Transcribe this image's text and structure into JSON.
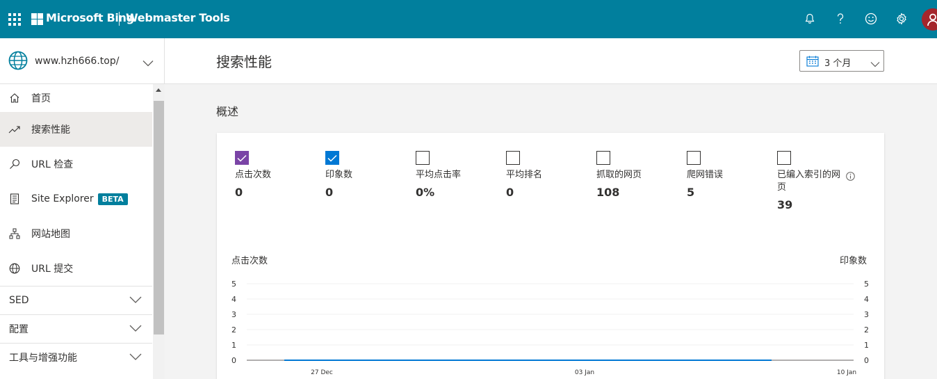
{
  "topbar": {
    "brand": "Microsoft Bing",
    "product": "Webmaster Tools",
    "icons": [
      "apps-waffle-icon",
      "bell-icon",
      "help-icon",
      "feedback-smile-icon",
      "gear-icon",
      "avatar-icon"
    ],
    "color": "#017f9d"
  },
  "site": {
    "url": "www.hzh666.top/"
  },
  "nav": {
    "items": [
      {
        "label": "首页",
        "icon": "home-icon"
      },
      {
        "label": "搜索性能",
        "icon": "trend-icon",
        "active": true
      },
      {
        "label": "URL 检查",
        "icon": "search-icon"
      },
      {
        "label": "Site Explorer",
        "icon": "document-icon",
        "badge": "BETA"
      },
      {
        "label": "网站地图",
        "icon": "sitemap-icon"
      },
      {
        "label": "URL 提交",
        "icon": "globe-icon"
      }
    ],
    "groups": [
      {
        "label": "SED"
      },
      {
        "label": "配置"
      },
      {
        "label": "工具与增强功能"
      }
    ]
  },
  "page": {
    "title": "搜索性能",
    "date_range": "3 个月",
    "section": "概述"
  },
  "metrics": [
    {
      "label": "点击次数",
      "value": "0",
      "checked": true,
      "color": "#7a44a6"
    },
    {
      "label": "印象数",
      "value": "0",
      "checked": true,
      "color": "#0078d4"
    },
    {
      "label": "平均点击率",
      "value": "0%",
      "checked": false
    },
    {
      "label": "平均排名",
      "value": "0",
      "checked": false
    },
    {
      "label": "抓取的网页",
      "value": "108",
      "checked": false
    },
    {
      "label": "爬网错误",
      "value": "5",
      "checked": false
    },
    {
      "label": "已编入索引的网页",
      "value": "39",
      "checked": false,
      "info": true
    }
  ],
  "chart_data": {
    "type": "line",
    "left_axis_label": "点击次数",
    "right_axis_label": "印象数",
    "y_ticks": [
      "5",
      "4",
      "3",
      "2",
      "1",
      "0"
    ],
    "ylim": [
      0,
      5
    ],
    "x_ticks": [
      "27 Dec",
      "03 Jan",
      "10 Jan"
    ],
    "series": [
      {
        "name": "点击次数",
        "color": "#7a44a6",
        "values": [
          0,
          0
        ]
      },
      {
        "name": "印象数",
        "color": "#0078d4",
        "values": [
          0,
          0
        ]
      }
    ]
  }
}
